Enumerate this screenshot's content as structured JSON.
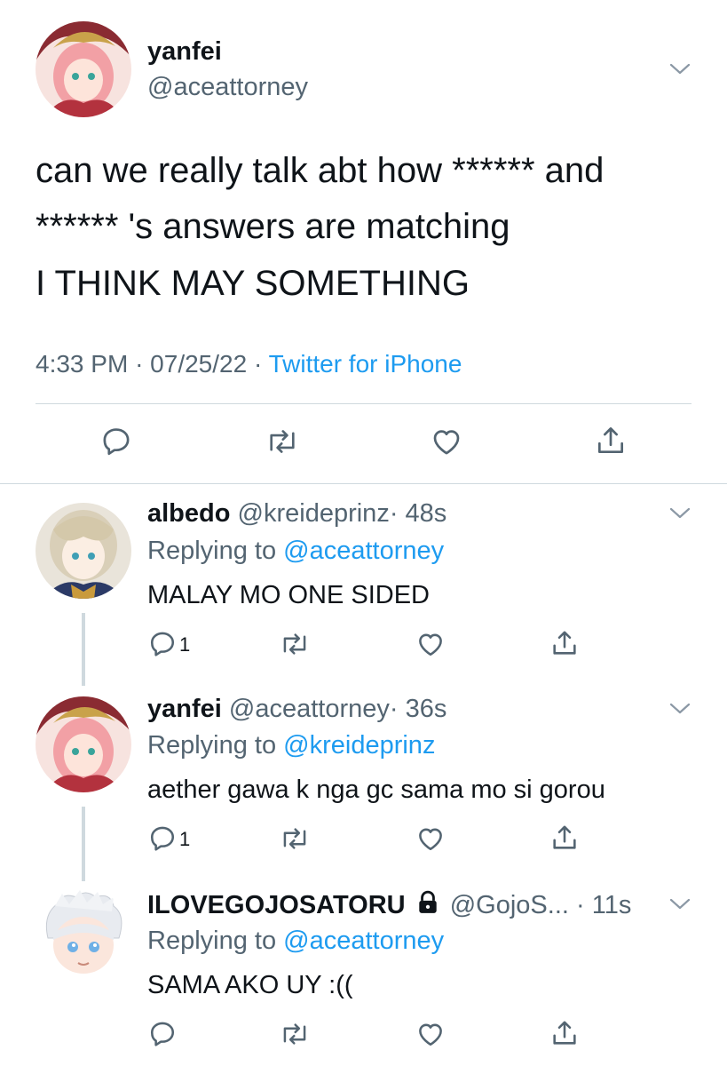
{
  "main_tweet": {
    "display_name": "yanfei",
    "handle": "@aceattorney",
    "text_line1": "can we really talk abt how ****** and",
    "text_line2": "****** 's answers are matching",
    "text_line3": "I THINK MAY SOMETHING",
    "time": "4:33 PM",
    "date": "07/25/22",
    "separator": "·",
    "source": "Twitter for iPhone"
  },
  "replies": [
    {
      "display_name": "albedo",
      "handle": "@kreideprinz",
      "age": "· 48s",
      "replying_prefix": "Replying to",
      "replying_to": "@aceattorney",
      "text": "MALAY MO ONE SIDED",
      "reply_count": "1"
    },
    {
      "display_name": "yanfei",
      "handle": "@aceattorney",
      "age": "· 36s",
      "replying_prefix": "Replying to",
      "replying_to": "@kreideprinz",
      "text": "aether gawa k nga gc sama mo si gorou",
      "reply_count": "1"
    },
    {
      "display_name": "ILOVEGOJOSATORU",
      "handle": "@GojoS...",
      "age": "· 11s",
      "replying_prefix": "Replying to",
      "replying_to": "@aceattorney",
      "text": "SAMA AKO UY :((",
      "reply_count": ""
    }
  ],
  "colors": {
    "accent": "#1d9bf0",
    "muted": "#536471",
    "divider": "#cfd9de"
  }
}
